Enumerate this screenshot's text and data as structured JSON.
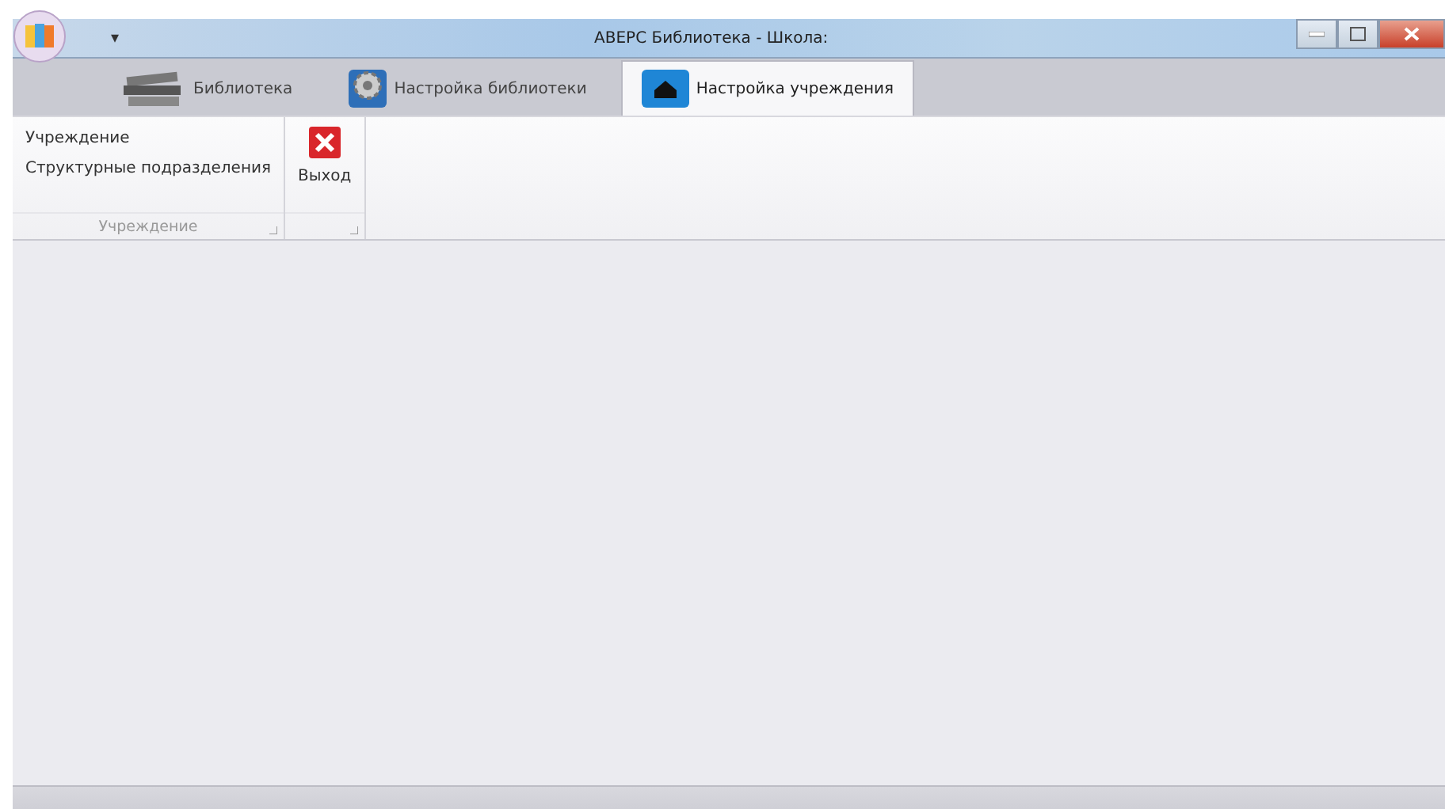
{
  "window": {
    "title": "АВЕРС Библиотека - Школа:",
    "quick_access": "▾"
  },
  "tabs": [
    {
      "label": "Библиотека",
      "kind": "books",
      "selected": false
    },
    {
      "label": "Настройка библиотеки",
      "kind": "gear",
      "selected": false
    },
    {
      "label": "Настройка учреждения",
      "kind": "house",
      "selected": true
    }
  ],
  "ribbon_groups": [
    {
      "label": "Учреждение",
      "items": [
        {
          "label": "Учреждение",
          "kind": "text"
        },
        {
          "label": "Структурные подразделения",
          "kind": "text"
        }
      ]
    },
    {
      "items": [
        {
          "label": "Выход",
          "kind": "exit"
        }
      ]
    }
  ]
}
